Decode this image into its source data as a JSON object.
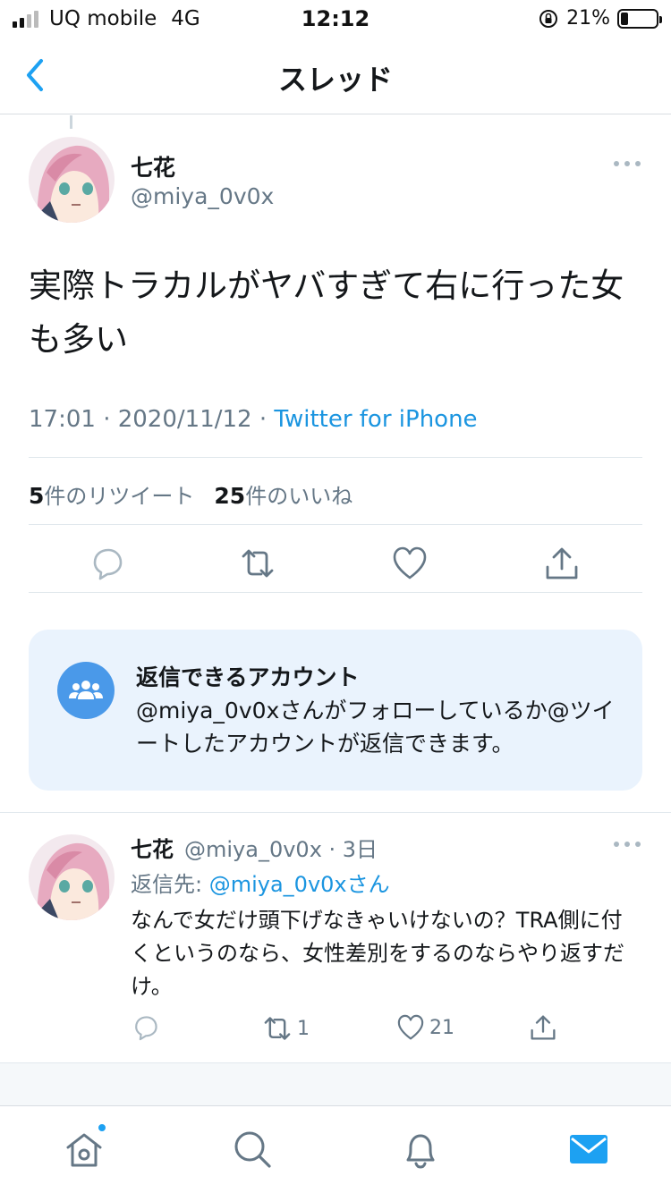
{
  "status_bar": {
    "carrier": "UQ mobile",
    "network": "4G",
    "time": "12:12",
    "battery_percent": "21%",
    "battery_level": 0.21
  },
  "nav": {
    "title": "スレッド"
  },
  "main_tweet": {
    "name": "七花",
    "handle": "@miya_0v0x",
    "text": "実際トラカルがヤバすぎて右に行った女も多い",
    "time": "17:01 · 2020/11/12 · ",
    "client": "Twitter for iPhone",
    "retweet_count": "5",
    "retweet_label": "件のリツイート",
    "like_count": "25",
    "like_label": "件のいいね"
  },
  "reply_restriction": {
    "title": "返信できるアカウント",
    "body": "@miya_0v0xさんがフォローしているか@ツイートしたアカウントが返信できます。"
  },
  "reply_tweet": {
    "name": "七花",
    "handle": "@miya_0v0x · 3日",
    "reply_to_prefix": "返信先: ",
    "reply_to_mention": "@miya_0v0xさん",
    "text": "なんで女だけ頭下げなきゃいけないの？TRA側に付くというのなら、女性差別をするのならやり返すだけ。",
    "retweets": "1",
    "likes": "21"
  },
  "colors": {
    "accent": "#1da1f2",
    "link": "#1b95e0",
    "secondary_text": "#657786",
    "card_bg": "#eaf3fd"
  },
  "icons": {
    "back": "chevron-left-icon",
    "more": "more-dots-icon",
    "reply": "comment-icon",
    "retweet": "retweet-icon",
    "like": "heart-icon",
    "share": "share-icon",
    "group": "people-icon",
    "home": "home-icon",
    "search": "search-icon",
    "notifications": "bell-icon",
    "messages": "mail-icon"
  }
}
